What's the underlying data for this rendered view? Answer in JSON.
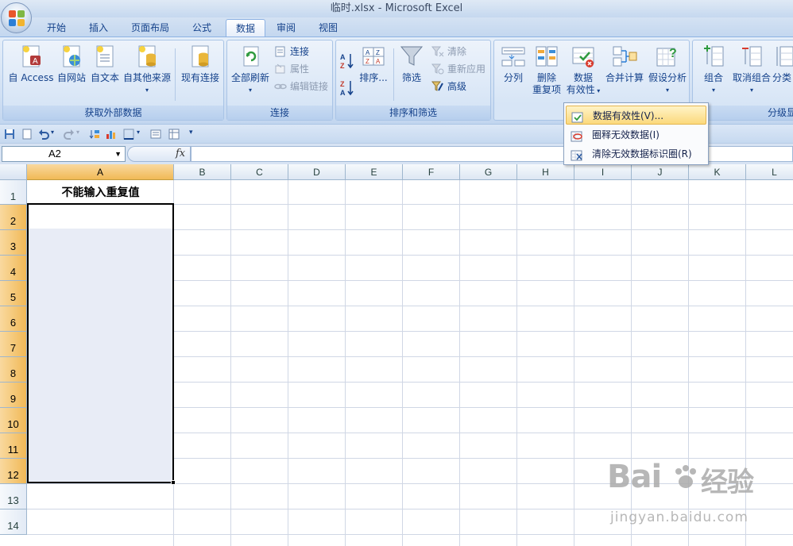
{
  "window": {
    "title": "临时.xlsx - Microsoft Excel"
  },
  "tabs": [
    "开始",
    "插入",
    "页面布局",
    "公式",
    "数据",
    "审阅",
    "视图"
  ],
  "active_tab": "数据",
  "ribbon": {
    "get_external": {
      "title": "获取外部数据",
      "access": "自 Access",
      "web": "自网站",
      "text": "自文本",
      "other": "自其他来源",
      "existing": "现有连接"
    },
    "connections": {
      "title": "连接",
      "refresh_all": "全部刷新",
      "connections": "连接",
      "properties": "属性",
      "edit_links": "编辑链接"
    },
    "sort_filter": {
      "title": "排序和筛选",
      "sort": "排序...",
      "filter": "筛选",
      "clear": "清除",
      "reapply": "重新应用",
      "advanced": "高级"
    },
    "data_tools": {
      "split": "分列",
      "remove_dup_1": "删除",
      "remove_dup_2": "重复项",
      "validation_1": "数据",
      "validation_2": "有效性",
      "consolidate": "合并计算",
      "whatif": "假设分析"
    },
    "outline": {
      "title": "分级显",
      "group": "组合",
      "ungroup": "取消组合",
      "subtotal": "分类"
    }
  },
  "validation_menu": [
    {
      "label": "数据有效性(V)...",
      "highlight": true
    },
    {
      "label": "圈释无效数据(I)",
      "highlight": false
    },
    {
      "label": "清除无效数据标识圈(R)",
      "highlight": false
    }
  ],
  "formula_bar": {
    "name_box": "A2",
    "fx": "fx",
    "value": ""
  },
  "columns": [
    "A",
    "B",
    "C",
    "D",
    "E",
    "F",
    "G",
    "H",
    "I",
    "J",
    "K",
    "L"
  ],
  "rows": [
    "1",
    "2",
    "3",
    "4",
    "5",
    "6",
    "7",
    "8",
    "9",
    "10",
    "11",
    "12",
    "13",
    "14"
  ],
  "cells": {
    "A1": "不能输入重复值"
  },
  "watermark": {
    "logo_left": "Bai",
    "logo_right": "经验",
    "url": "jingyan.baidu.com"
  }
}
